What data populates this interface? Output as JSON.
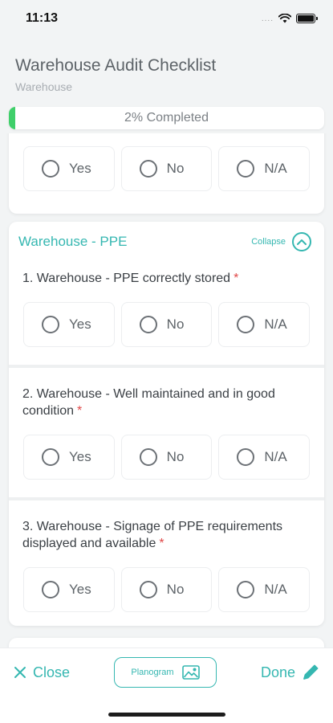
{
  "status_bar": {
    "time": "11:13",
    "signal": "....",
    "icons": [
      "wifi-icon",
      "battery-icon"
    ]
  },
  "header": {
    "title": "Warehouse Audit Checklist",
    "subtitle": "Warehouse"
  },
  "progress": {
    "percent": 2,
    "label": "2% Completed",
    "color": "#3fcf6a"
  },
  "options": {
    "yes": "Yes",
    "no": "No",
    "na": "N/A"
  },
  "section_ppe": {
    "title": "Warehouse - PPE",
    "collapse_label": "Collapse",
    "questions": [
      {
        "text": "1. Warehouse - PPE correctly stored",
        "required": "*"
      },
      {
        "text": "2. Warehouse - Well maintained and in good condition",
        "required": "*"
      },
      {
        "text": "3. Warehouse - Signage of PPE requirements displayed and available",
        "required": "*"
      }
    ]
  },
  "bottom_bar": {
    "close_label": "Close",
    "planogram_label": "Planogram",
    "done_label": "Done"
  },
  "colors": {
    "accent": "#35b7b1",
    "required": "#e04848",
    "background": "#f2f4f5"
  }
}
